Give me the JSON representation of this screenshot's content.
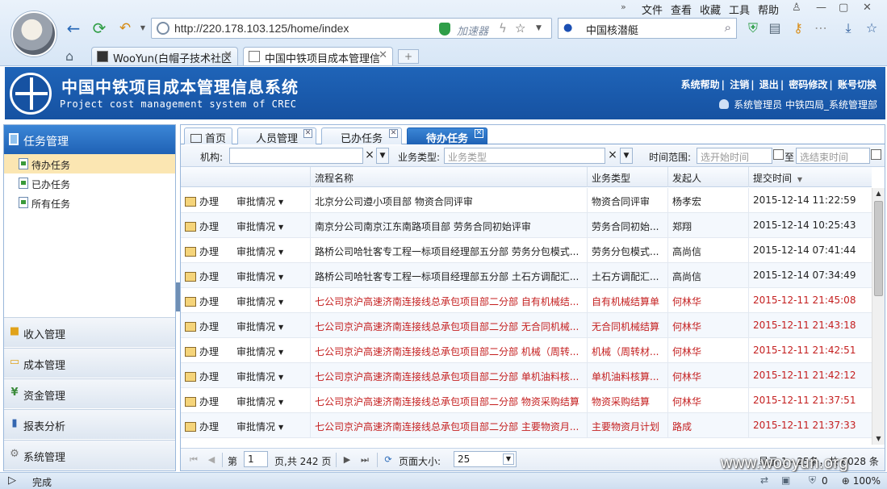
{
  "browser": {
    "menu": [
      "文件",
      "查看",
      "收藏",
      "工具",
      "帮助"
    ],
    "url": "http://220.178.103.125/home/index",
    "accelerator_label": "加速器",
    "search_value": "中国核潜艇",
    "tabs": [
      {
        "label": "WooYun(白帽子技术社区",
        "active": false
      },
      {
        "label": "中国中铁项目成本管理信",
        "active": true
      }
    ],
    "new_tab_label": "+",
    "status_text": "完成",
    "zoom": "100%",
    "download_count": "0"
  },
  "app": {
    "title": "中国中铁项目成本管理信息系统",
    "subtitle": "Project cost management system of CREC",
    "logo_text": "CREC",
    "top_links": [
      "系统帮助",
      "注销",
      "退出",
      "密码修改",
      "账号切换"
    ],
    "link_separator": "|",
    "user": "系统管理员 中铁四局_系统管理部"
  },
  "sidebar": {
    "header": "任务管理",
    "items": [
      {
        "label": "待办任务",
        "active": true
      },
      {
        "label": "已办任务",
        "active": false
      },
      {
        "label": "所有任务",
        "active": false
      }
    ],
    "sections": [
      {
        "label": "收入管理",
        "icon": "folder-icon"
      },
      {
        "label": "成本管理",
        "icon": "folder-open-icon"
      },
      {
        "label": "资金管理",
        "icon": "yen-icon"
      },
      {
        "label": "报表分析",
        "icon": "bar-chart-icon"
      },
      {
        "label": "系统管理",
        "icon": "gear-icon"
      }
    ]
  },
  "panel_tabs": [
    {
      "label": "首页",
      "closable": false,
      "active": false
    },
    {
      "label": "人员管理",
      "closable": true,
      "active": false
    },
    {
      "label": "已办任务",
      "closable": true,
      "active": false
    },
    {
      "label": "待办任务",
      "closable": true,
      "active": true
    }
  ],
  "filter": {
    "org_label": "机构:",
    "org_value": "",
    "type_label": "业务类型:",
    "type_placeholder": "业务类型",
    "time_label": "时间范围:",
    "start_placeholder": "选开始时间",
    "to_label": "至",
    "end_placeholder": "选结束时间"
  },
  "table": {
    "columns": [
      "流程名称",
      "业务类型",
      "发起人",
      "提交时间"
    ],
    "sort_indicator": "▼",
    "action_label": "办理",
    "status_label": "审批情况",
    "rows": [
      {
        "name": "北京分公司遵小项目部 物资合同评审",
        "type": "物资合同评审",
        "initiator": "杨孝宏",
        "time": "2015-12-14 11:22:59",
        "red": false
      },
      {
        "name": "南京分公司南京江东南路项目部 劳务合同初始评审",
        "type": "劳务合同初始...",
        "initiator": "郑翔",
        "time": "2015-12-14 10:25:43",
        "red": false
      },
      {
        "name": "路桥公司哈牡客专工程一标项目经理部五分部 劳务分包模式...",
        "type": "劳务分包模式...",
        "initiator": "高尚信",
        "time": "2015-12-14 07:41:44",
        "red": false
      },
      {
        "name": "路桥公司哈牡客专工程一标项目经理部五分部 土石方调配汇...",
        "type": "土石方调配汇...",
        "initiator": "高尚信",
        "time": "2015-12-14 07:34:49",
        "red": false
      },
      {
        "name": "七公司京沪高速济南连接线总承包项目部二分部 自有机械结...",
        "type": "自有机械结算单",
        "initiator": "何林华",
        "time": "2015-12-11 21:45:08",
        "red": true
      },
      {
        "name": "七公司京沪高速济南连接线总承包项目部二分部 无合同机械...",
        "type": "无合同机械结算",
        "initiator": "何林华",
        "time": "2015-12-11 21:43:18",
        "red": true
      },
      {
        "name": "七公司京沪高速济南连接线总承包项目部二分部 机械（周转...",
        "type": "机械（周转材...",
        "initiator": "何林华",
        "time": "2015-12-11 21:42:51",
        "red": true
      },
      {
        "name": "七公司京沪高速济南连接线总承包项目部二分部 单机油料核...",
        "type": "单机油料核算...",
        "initiator": "何林华",
        "time": "2015-12-11 21:42:12",
        "red": true
      },
      {
        "name": "七公司京沪高速济南连接线总承包项目部二分部 物资采购结算",
        "type": "物资采购结算",
        "initiator": "何林华",
        "time": "2015-12-11 21:37:51",
        "red": true
      },
      {
        "name": "七公司京沪高速济南连接线总承包项目部二分部 主要物资月...",
        "type": "主要物资月计划",
        "initiator": "路成",
        "time": "2015-12-11 21:37:33",
        "red": true
      }
    ]
  },
  "pager": {
    "page_prefix": "第",
    "page_value": "1",
    "page_suffix": "页,共 242 页",
    "size_label": "页面大小:",
    "size_value": "25",
    "summary": "显示 1 - 25条，共 6028 条"
  },
  "watermark": "www.wooyun.org",
  "colors": {
    "brand": "#1f62b5",
    "alert": "#c41e1e",
    "active_item": "#fbe6b2"
  }
}
